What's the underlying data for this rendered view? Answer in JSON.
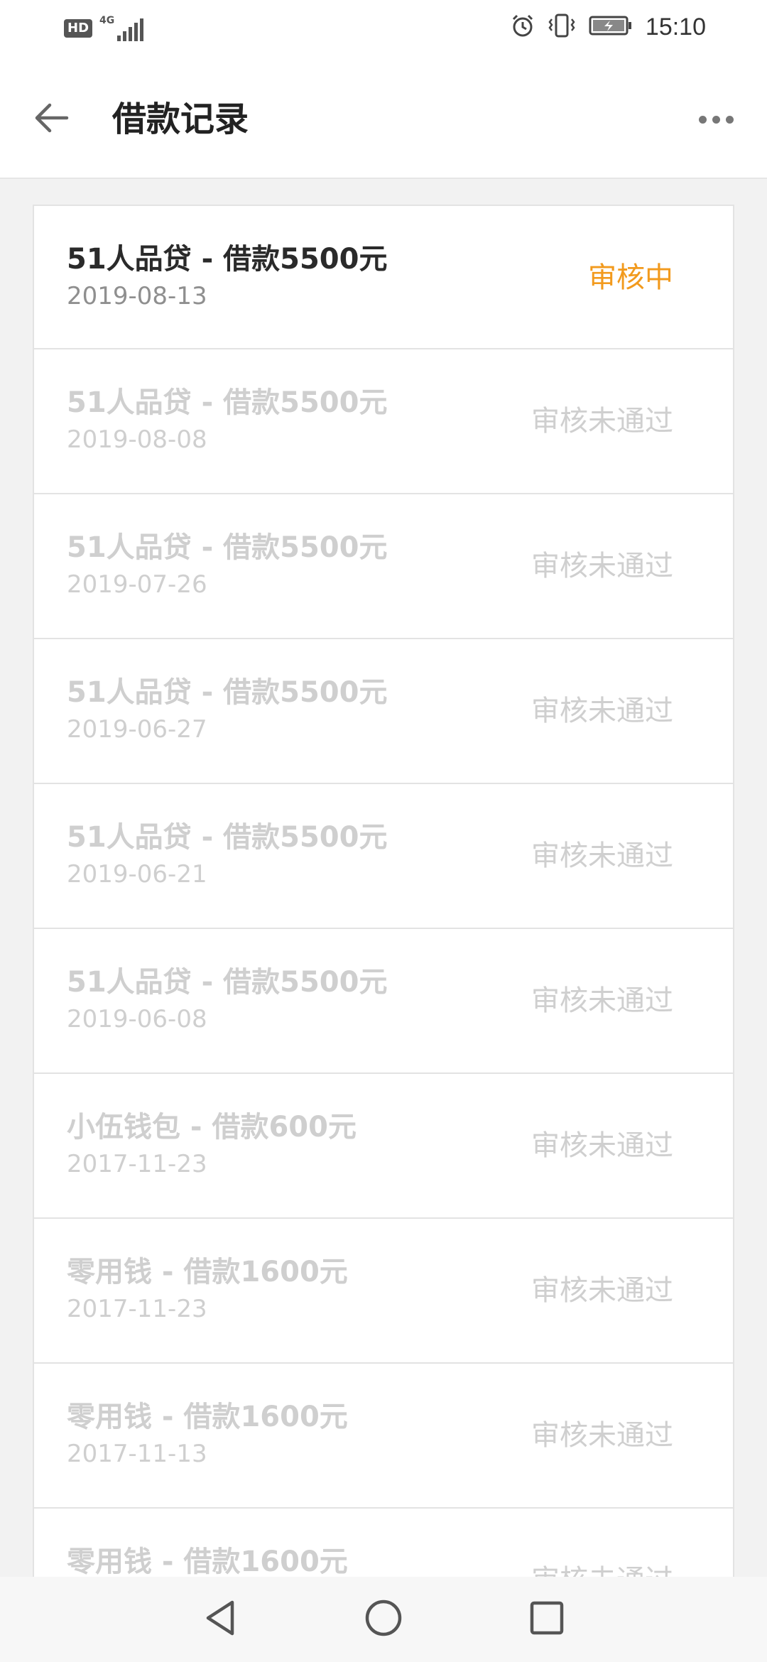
{
  "status_bar": {
    "hd_badge": "HD",
    "network": "4G",
    "time": "15:10",
    "icons": [
      "alarm-icon",
      "vibrate-icon",
      "battery-charging-icon"
    ]
  },
  "app_bar": {
    "title": "借款记录",
    "back_icon": "arrow-left-icon",
    "more_icon": "more-horizontal-icon"
  },
  "colors": {
    "pending_status": "#f29a1d",
    "inactive_text": "#cfcfcf",
    "active_title": "#2a2a2a"
  },
  "records": [
    {
      "title": "51人品贷 - 借款5500元",
      "date": "2019-08-13",
      "status": "审核中",
      "active": true
    },
    {
      "title": "51人品贷 - 借款5500元",
      "date": "2019-08-08",
      "status": "审核未通过",
      "active": false
    },
    {
      "title": "51人品贷 - 借款5500元",
      "date": "2019-07-26",
      "status": "审核未通过",
      "active": false
    },
    {
      "title": "51人品贷 - 借款5500元",
      "date": "2019-06-27",
      "status": "审核未通过",
      "active": false
    },
    {
      "title": "51人品贷 - 借款5500元",
      "date": "2019-06-21",
      "status": "审核未通过",
      "active": false
    },
    {
      "title": "51人品贷 - 借款5500元",
      "date": "2019-06-08",
      "status": "审核未通过",
      "active": false
    },
    {
      "title": "小伍钱包 - 借款600元",
      "date": "2017-11-23",
      "status": "审核未通过",
      "active": false
    },
    {
      "title": "零用钱 - 借款1600元",
      "date": "2017-11-23",
      "status": "审核未通过",
      "active": false
    },
    {
      "title": "零用钱 - 借款1600元",
      "date": "2017-11-13",
      "status": "审核未通过",
      "active": false
    },
    {
      "title": "零用钱 - 借款1600元",
      "date": "",
      "status": "审核未通过",
      "active": false
    }
  ],
  "nav_bar": {
    "icons": [
      "back-triangle-icon",
      "home-circle-icon",
      "recents-square-icon"
    ]
  }
}
